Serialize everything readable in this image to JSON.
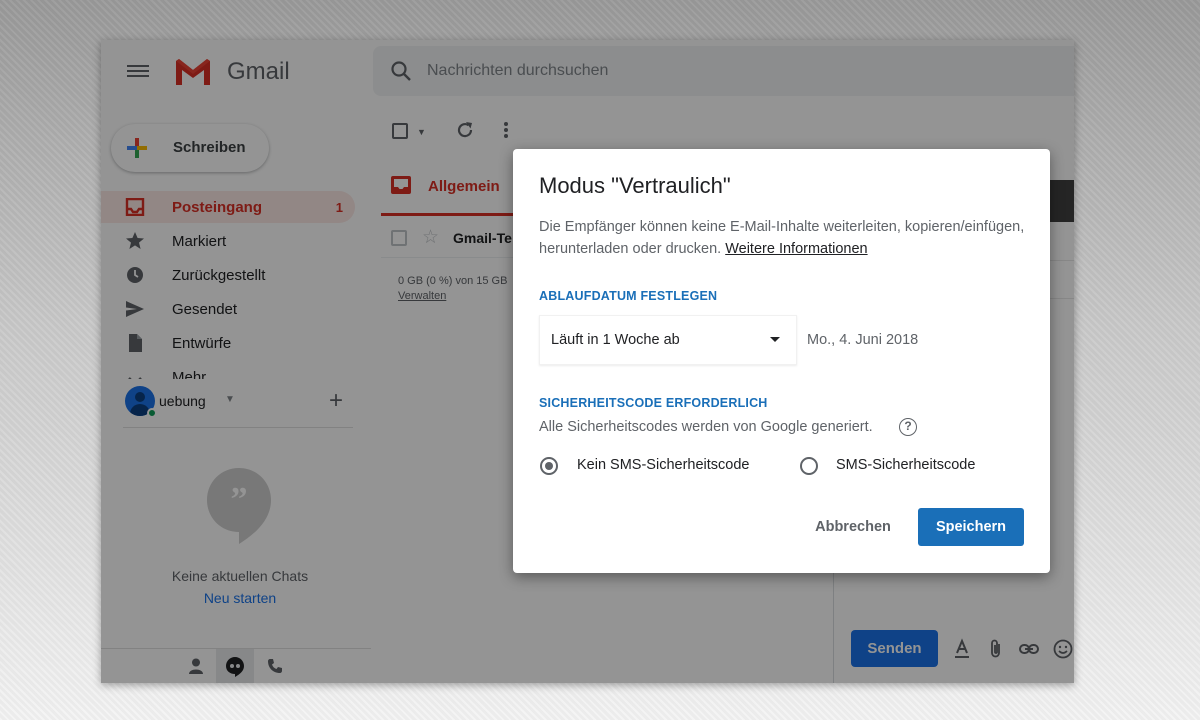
{
  "app": {
    "name": "Gmail"
  },
  "search": {
    "placeholder": "Nachrichten durchsuchen"
  },
  "sidebar": {
    "compose_label": "Schreiben",
    "items": [
      {
        "label": "Posteingang",
        "count": "1",
        "icon": "inbox-icon"
      },
      {
        "label": "Markiert",
        "icon": "star-icon"
      },
      {
        "label": "Zurückgestellt",
        "icon": "clock-icon"
      },
      {
        "label": "Gesendet",
        "icon": "send-icon"
      },
      {
        "label": "Entwürfe",
        "icon": "draft-icon"
      },
      {
        "label": "Mehr",
        "icon": "chevron-down-icon"
      }
    ]
  },
  "hangouts": {
    "user": "uebung",
    "no_chats": "Keine aktuellen Chats",
    "new_chat": "Neu starten"
  },
  "mail": {
    "tab_label": "Allgemein",
    "row_sender": "Gmail-Te",
    "storage": "0 GB (0 %) von 15 GB",
    "manage": "Verwalten"
  },
  "compose": {
    "send_label": "Senden"
  },
  "dialog": {
    "title": "Modus \"Vertraulich\"",
    "description": "Die Empfänger können keine E-Mail-Inhalte weiterleiten, kopieren/einfügen, herunterladen oder drucken.",
    "link": "Weitere Informationen",
    "expiry_heading": "ABLAUFDATUM FESTLEGEN",
    "expiry_value": "Läuft in 1 Woche ab",
    "expiry_date": "Mo., 4. Juni 2018",
    "passcode_heading": "SICHERHEITSCODE ERFORDERLICH",
    "passcode_desc": "Alle Sicherheitscodes werden von Google generiert.",
    "option_no_sms": "Kein SMS-Sicherheitscode",
    "option_sms": "SMS-Sicherheitscode",
    "cancel_label": "Abbrechen",
    "save_label": "Speichern"
  },
  "colors": {
    "accent_red": "#d93025",
    "accent_blue": "#1a6fb8",
    "send_blue": "#1a73e8"
  }
}
